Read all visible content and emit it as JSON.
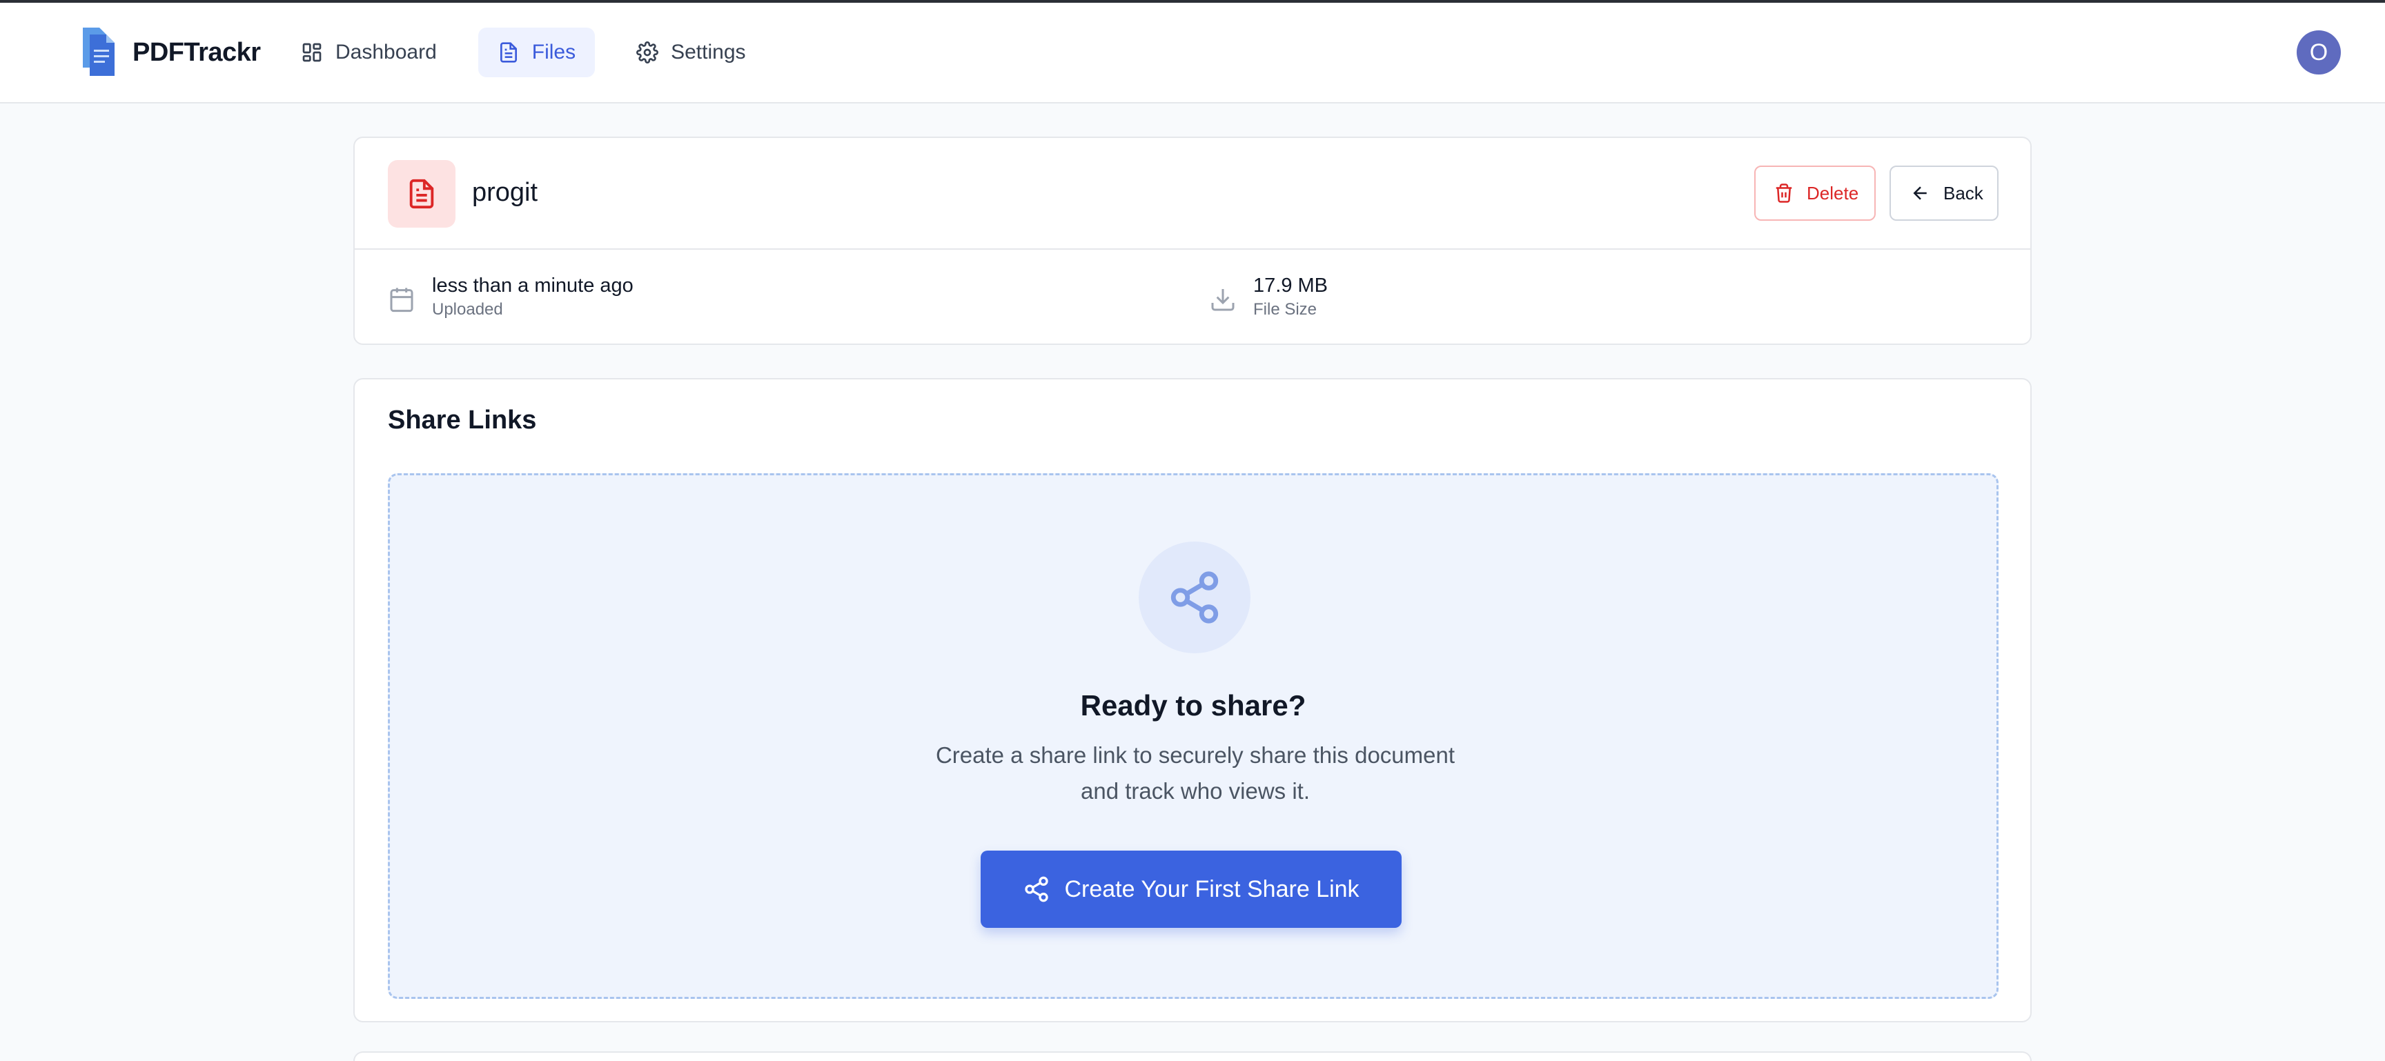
{
  "app": {
    "name": "PDFTrackr"
  },
  "nav": {
    "items": [
      {
        "label": "Dashboard",
        "icon": "dashboard-icon"
      },
      {
        "label": "Files",
        "icon": "file-icon",
        "active": true
      },
      {
        "label": "Settings",
        "icon": "gear-icon"
      }
    ]
  },
  "user": {
    "avatar_initial": "O"
  },
  "file": {
    "name": "progit",
    "delete_label": "Delete",
    "back_label": "Back",
    "uploaded_value": "less than a minute ago",
    "uploaded_label": "Uploaded",
    "size_value": "17.9 MB",
    "size_label": "File Size"
  },
  "share": {
    "title": "Share Links",
    "empty_heading": "Ready to share?",
    "empty_description": "Create a share link to securely share this document and track who views it.",
    "create_label": "Create Your First Share Link"
  },
  "colors": {
    "accent": "#3b63e0",
    "danger": "#dc2626",
    "active_nav_bg": "#eef2ff",
    "avatar_bg": "#5f6bbf"
  }
}
